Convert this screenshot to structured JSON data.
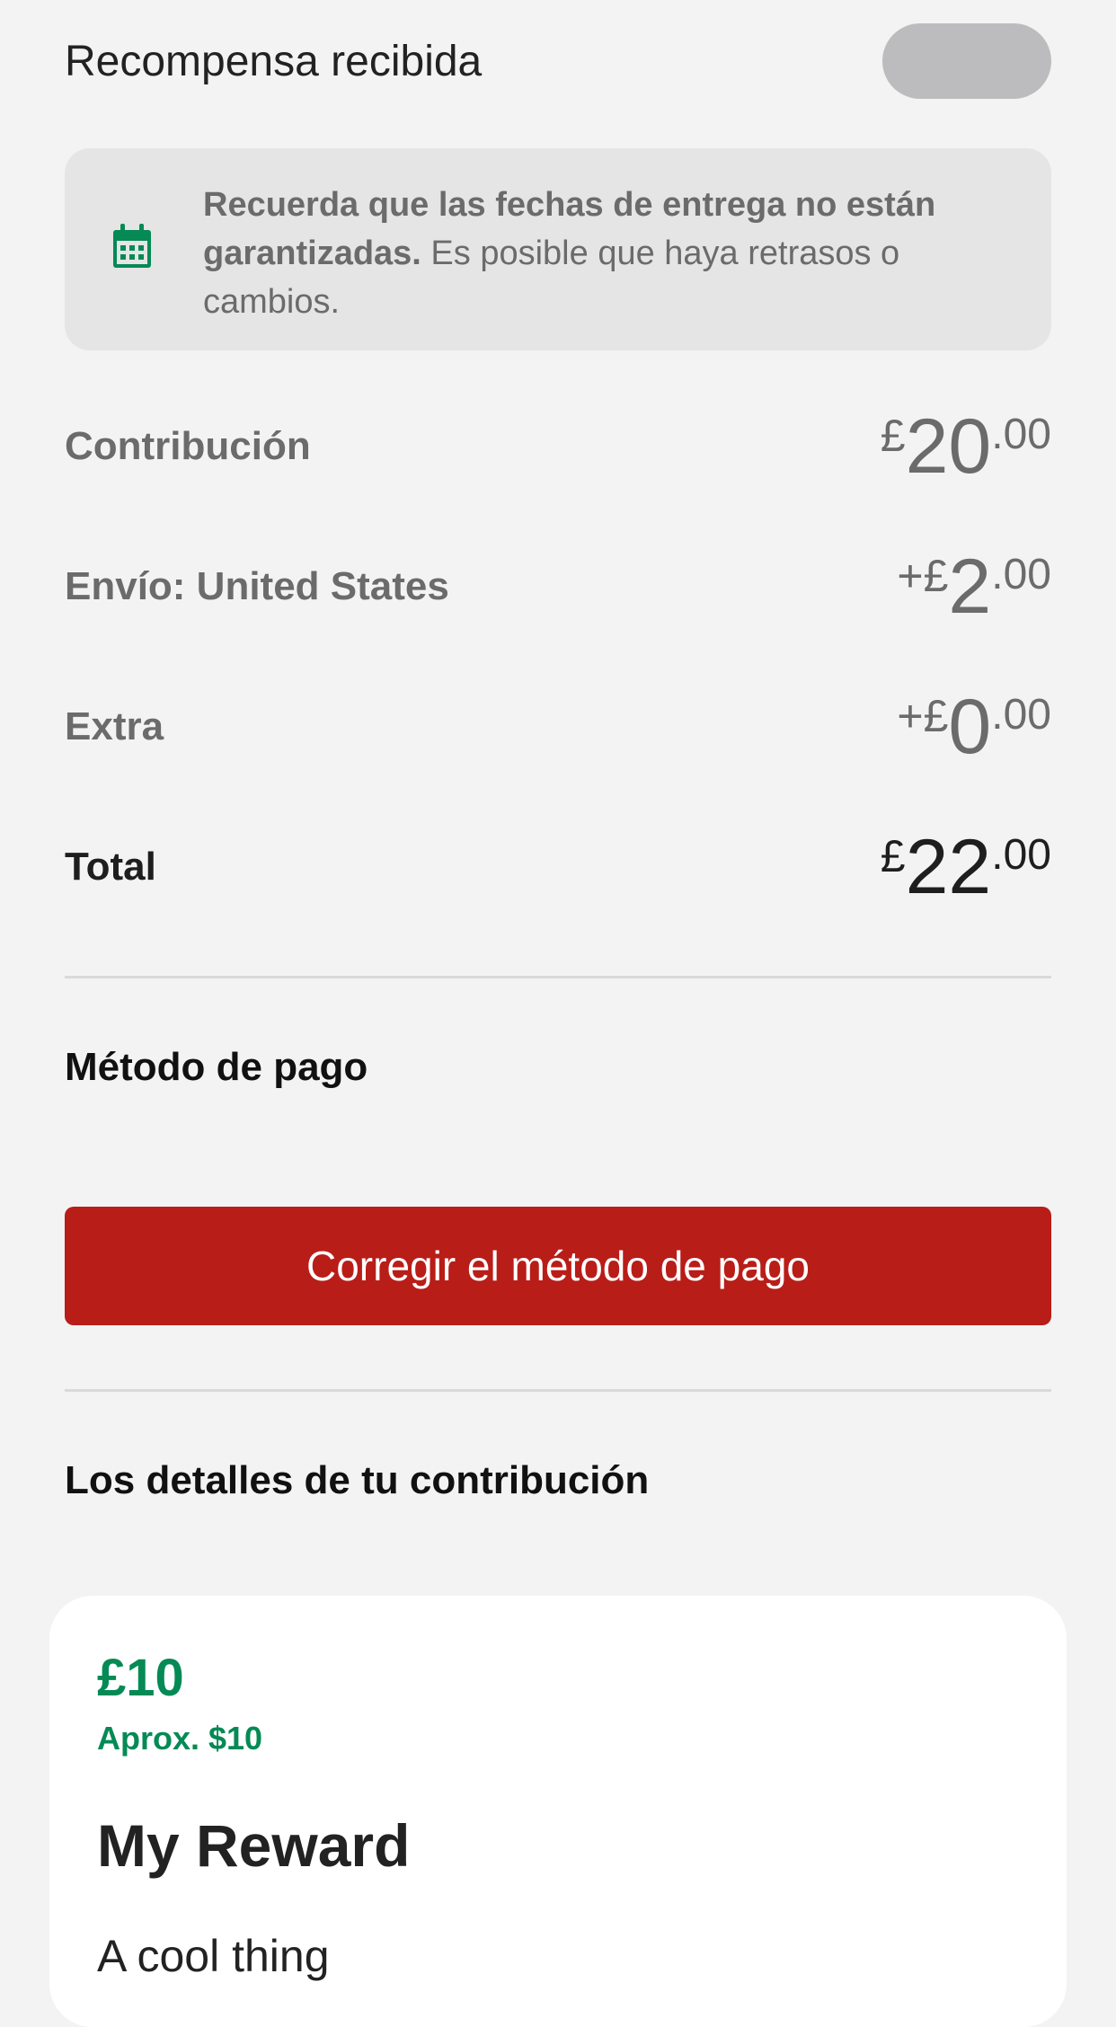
{
  "reward_received": {
    "label": "Recompensa recibida"
  },
  "info_banner": {
    "icon": "calendar-icon",
    "bold_text": "Recuerda que las fechas de entrega no están garantizadas.",
    "text": " Es posible que haya retrasos o cambios."
  },
  "summary": {
    "rows": [
      {
        "label": "Contribución",
        "prefix": "£",
        "major": "20",
        "minor": ".00"
      },
      {
        "label": "Envío: United States",
        "prefix": "+£",
        "major": "2",
        "minor": ".00"
      },
      {
        "label": "Extra",
        "prefix": "+£",
        "major": "0",
        "minor": ".00"
      }
    ],
    "total": {
      "label": "Total",
      "prefix": "£",
      "major": "22",
      "minor": ".00"
    }
  },
  "payment": {
    "title": "Método de pago",
    "fix_button_label": "Corregir el método de pago"
  },
  "details": {
    "title": "Los detalles de tu contribución"
  },
  "reward_card": {
    "price": "£10",
    "approx": "Aprox. $10",
    "title": "My Reward",
    "description": "A cool thing"
  },
  "colors": {
    "accent_green": "#058a55",
    "button_red": "#b91d18",
    "background": "#f3f3f3"
  }
}
